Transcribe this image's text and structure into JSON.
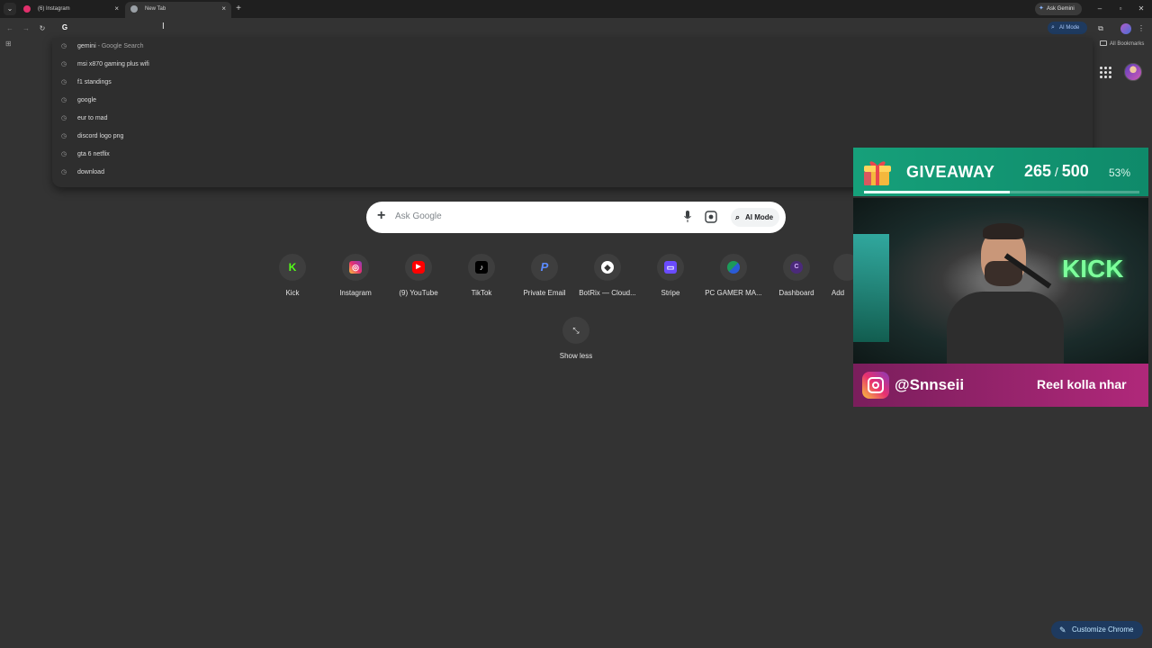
{
  "tabs": [
    {
      "title": "(6) Instagram",
      "active": false
    },
    {
      "title": "New Tab",
      "active": true
    }
  ],
  "titlebar": {
    "ask_gemini": "Ask Gemini"
  },
  "toolbar": {
    "omnibox_value": "",
    "ai_mode": "AI Mode"
  },
  "bookmarks": {
    "all_bookmarks": "All Bookmarks"
  },
  "suggestions": [
    {
      "text": "gemini",
      "sub": " - Google Search"
    },
    {
      "text": "msi x870 gaming plus wifi",
      "sub": ""
    },
    {
      "text": "f1 standings",
      "sub": ""
    },
    {
      "text": "google",
      "sub": ""
    },
    {
      "text": "eur to mad",
      "sub": ""
    },
    {
      "text": "discord logo png",
      "sub": ""
    },
    {
      "text": "gta 6 netflix",
      "sub": ""
    },
    {
      "text": "download",
      "sub": ""
    }
  ],
  "search": {
    "placeholder": "Ask Google",
    "ai_mode": "AI Mode"
  },
  "shortcuts": [
    {
      "label": "Kick",
      "icon": "kick-logo",
      "color": "#53fc18"
    },
    {
      "label": "Instagram",
      "icon": "instagram-logo",
      "color": "#e1306c"
    },
    {
      "label": "(9) YouTube",
      "icon": "youtube-logo",
      "color": "#ff0000"
    },
    {
      "label": "TikTok",
      "icon": "tiktok-logo",
      "color": "#000000"
    },
    {
      "label": "Private Email",
      "icon": "email-logo",
      "color": "#3d6bdc"
    },
    {
      "label": "BotRix — Cloud...",
      "icon": "botrix-logo",
      "color": "#ffffff"
    },
    {
      "label": "Stripe",
      "icon": "stripe-logo",
      "color": "#6a4bff"
    },
    {
      "label": "PC GAMER MA...",
      "icon": "pcgamer-logo",
      "color": "#1c9a5a"
    },
    {
      "label": "Dashboard",
      "icon": "dashboard-logo",
      "color": "#4b2a7a"
    },
    {
      "label": "Add",
      "icon": "add-shortcut",
      "color": "#3e3e3e"
    }
  ],
  "show_less": "Show less",
  "overlay": {
    "giveaway_title": "GIVEAWAY",
    "current": "265",
    "total": "500",
    "percent": "53%",
    "progress": 0.53,
    "handle": "@Snnseii",
    "message": "Reel kolla nhar"
  },
  "customize": "Customize Chrome",
  "colors": {
    "background": "#333333",
    "giveaway_green": "#16a07a",
    "instagram_pink": "#b0287a",
    "accent_blue": "#1e3a5f"
  }
}
